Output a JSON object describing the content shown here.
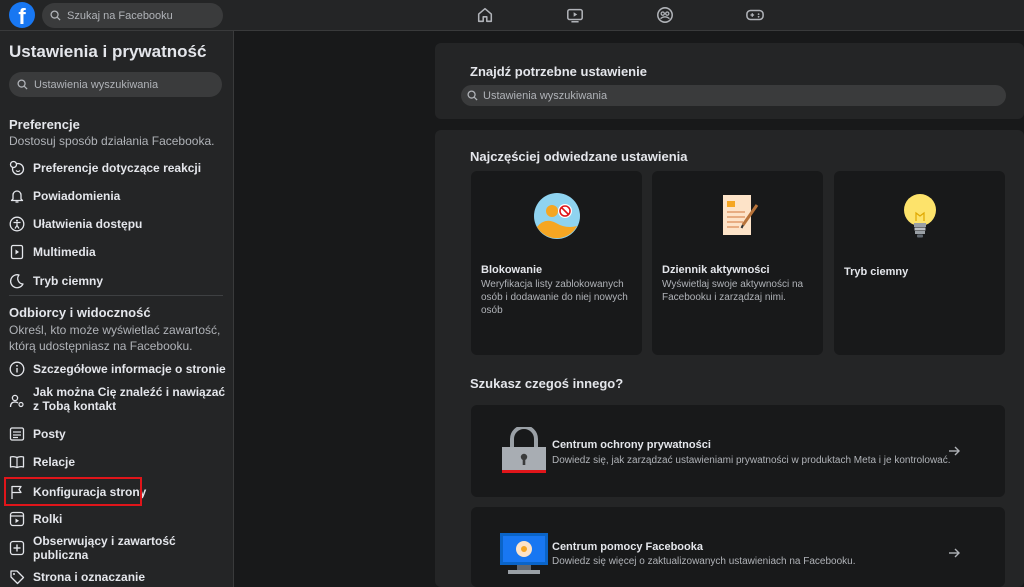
{
  "header": {
    "logo_letter": "f",
    "search_placeholder": "Szukaj na Facebooku",
    "nav_icons": [
      "home-icon",
      "video-icon",
      "groups-icon",
      "gaming-icon"
    ]
  },
  "sidebar": {
    "title": "Ustawienia i prywatność",
    "search_placeholder": "Ustawienia wyszukiwania",
    "preferences": {
      "heading": "Preferencje",
      "description": "Dostosuj sposób działania Facebooka.",
      "items": [
        {
          "label": "Preferencje dotyczące reakcji",
          "icon": "reactions-icon"
        },
        {
          "label": "Powiadomienia",
          "icon": "bell-icon"
        },
        {
          "label": "Ułatwienia dostępu",
          "icon": "accessibility-icon"
        },
        {
          "label": "Multimedia",
          "icon": "media-icon"
        },
        {
          "label": "Tryb ciemny",
          "icon": "moon-icon"
        }
      ]
    },
    "audience": {
      "heading": "Odbiorcy i widoczność",
      "description": "Określ, kto może wyświetlać zawartość, którą udostępniasz na Facebooku.",
      "items": [
        {
          "label": "Szczegółowe informacje o stronie",
          "icon": "info-icon"
        },
        {
          "label": "Jak można Cię znaleźć i nawiązać z Tobą kontakt",
          "icon": "find-contact-icon"
        },
        {
          "label": "Posty",
          "icon": "posts-icon"
        },
        {
          "label": "Relacje",
          "icon": "stories-icon"
        },
        {
          "label": "Konfiguracja strony",
          "icon": "flag-icon"
        },
        {
          "label": "Rolki",
          "icon": "reels-icon"
        },
        {
          "label": "Obserwujący i zawartość publiczna",
          "icon": "followers-icon"
        },
        {
          "label": "Strona i oznaczanie",
          "icon": "tag-icon"
        }
      ]
    }
  },
  "main": {
    "find_setting": {
      "title": "Znajdź potrzebne ustawienie",
      "search_placeholder": "Ustawienia wyszukiwania"
    },
    "frequent": {
      "title": "Najczęściej odwiedzane ustawienia",
      "tiles": [
        {
          "title": "Blokowanie",
          "description": "Weryfikacja listy zablokowanych osób i dodawanie do niej nowych osób",
          "icon": "blocked-user-icon"
        },
        {
          "title": "Dziennik aktywności",
          "description": "Wyświetlaj swoje aktywności na Facebooku i zarządzaj nimi.",
          "icon": "activity-log-icon"
        },
        {
          "title": "Tryb ciemny",
          "description": "",
          "icon": "lightbulb-icon"
        }
      ]
    },
    "looking_for": {
      "title": "Szukasz czegoś innego?",
      "rows": [
        {
          "title": "Centrum ochrony prywatności",
          "description": "Dowiedz się, jak zarządzać ustawieniami prywatności w produktach Meta i je kontrolować.",
          "icon": "padlock-icon"
        },
        {
          "title": "Centrum pomocy Facebooka",
          "description": "Dowiedz się więcej o zaktualizowanych ustawieniach na Facebooku.",
          "icon": "help-monitor-icon"
        }
      ]
    }
  },
  "colors": {
    "accent": "#1877f2",
    "highlight": "#e0151a",
    "background": "#18191a",
    "surface": "#242526"
  }
}
